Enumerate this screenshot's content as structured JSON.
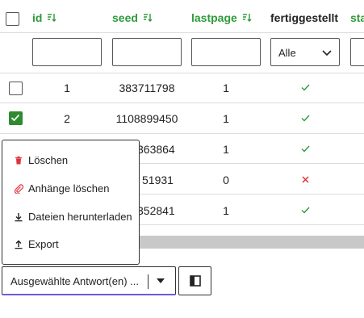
{
  "table": {
    "columns": {
      "id": "id",
      "seed": "seed",
      "lastpage": "lastpage",
      "fertiggestellt": "fertiggestellt",
      "st": "sta"
    },
    "filter_select_value": "Alle",
    "rows": [
      {
        "id": "1",
        "seed": "383711798",
        "lastpage": "1",
        "done": "check",
        "checked": false
      },
      {
        "id": "2",
        "seed": "1108899450",
        "lastpage": "1",
        "done": "check",
        "checked": true
      },
      {
        "id": "",
        "seed": "363864",
        "lastpage": "1",
        "done": "check",
        "checked": false
      },
      {
        "id": "",
        "seed": "51931",
        "lastpage": "0",
        "done": "cross",
        "checked": false
      },
      {
        "id": "",
        "seed": "352841",
        "lastpage": "1",
        "done": "check",
        "checked": false
      }
    ]
  },
  "menu": {
    "items": [
      {
        "label": "Löschen",
        "icon": "trash-icon",
        "color": "#e0323c"
      },
      {
        "label": "Anhänge löschen",
        "icon": "paperclip-icon",
        "color": "#e0323c"
      },
      {
        "label": "Dateien herunterladen",
        "icon": "download-icon",
        "color": "#222222"
      },
      {
        "label": "Export",
        "icon": "upload-icon",
        "color": "#222222"
      }
    ]
  },
  "actions": {
    "select_label": "Ausgewählte Antwort(en) ...",
    "toggle_icon": "sidebar-toggle-icon"
  },
  "colors": {
    "accent_green": "#2e9b3b",
    "checkbox_green": "#2e8b2e",
    "error_red": "#e0323c",
    "focus_purple": "#6b5be0"
  }
}
